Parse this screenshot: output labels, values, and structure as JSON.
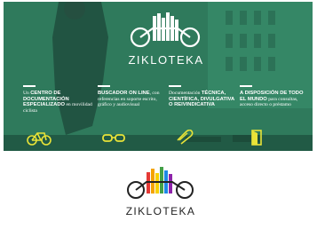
{
  "hero": {
    "brand": "ZIKLOTEKA",
    "columns": [
      {
        "strong": "CENTRO DE DOCUMENTACIÓN ESPECIALIZADO",
        "prefix": "Un",
        "suffix": "en movilidad ciclista",
        "icon": "bicycle-icon"
      },
      {
        "strong": "BUSCADOR ON LINE",
        "prefix": "",
        "suffix": ", con referencias en soporte escrito, gráfico y audiovisual",
        "icon": "glasses-icon"
      },
      {
        "strong": "TÉCNICA, CIENTÍFICA, DIVULGATIVA O REIVINDICATIVA",
        "prefix": "Documentación",
        "suffix": "",
        "icon": "paperclip-icon"
      },
      {
        "strong": "A DISPOSICIÓN DE TODO EL MUNDO",
        "prefix": "",
        "suffix": "para consultas, acceso directo o préstamo",
        "icon": "door-icon"
      }
    ]
  },
  "footer": {
    "brand": "ZIKLOTEKA"
  },
  "colors": {
    "overlay": "#2f7a5c",
    "accent_yellow": "#e8e338",
    "book_colors": [
      "#e53935",
      "#f4a300",
      "#f7d000",
      "#43a047",
      "#1e88e5",
      "#8e24aa"
    ]
  }
}
